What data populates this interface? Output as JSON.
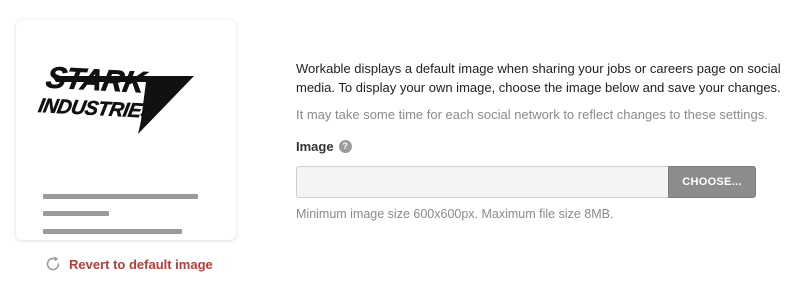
{
  "preview": {
    "logo_line1": "STARK",
    "logo_line2": "INDUSTRIES",
    "logo_icon": "stark-industries-logo"
  },
  "revert": {
    "label": "Revert to default image",
    "icon": "revert-icon",
    "color": "#b83a3a"
  },
  "description": {
    "line1": "Workable displays a default image when sharing your jobs or careers page on social",
    "line2": "media. To display your own image, choose the image below and save your changes.",
    "note": "It may take some time for each social network to reflect changes to these settings."
  },
  "image_field": {
    "label": "Image",
    "help_icon": "help-icon",
    "help_glyph": "?",
    "value": "",
    "button_label": "CHOOSE...",
    "hint": "Minimum image size 600x600px. Maximum file size 8MB."
  }
}
